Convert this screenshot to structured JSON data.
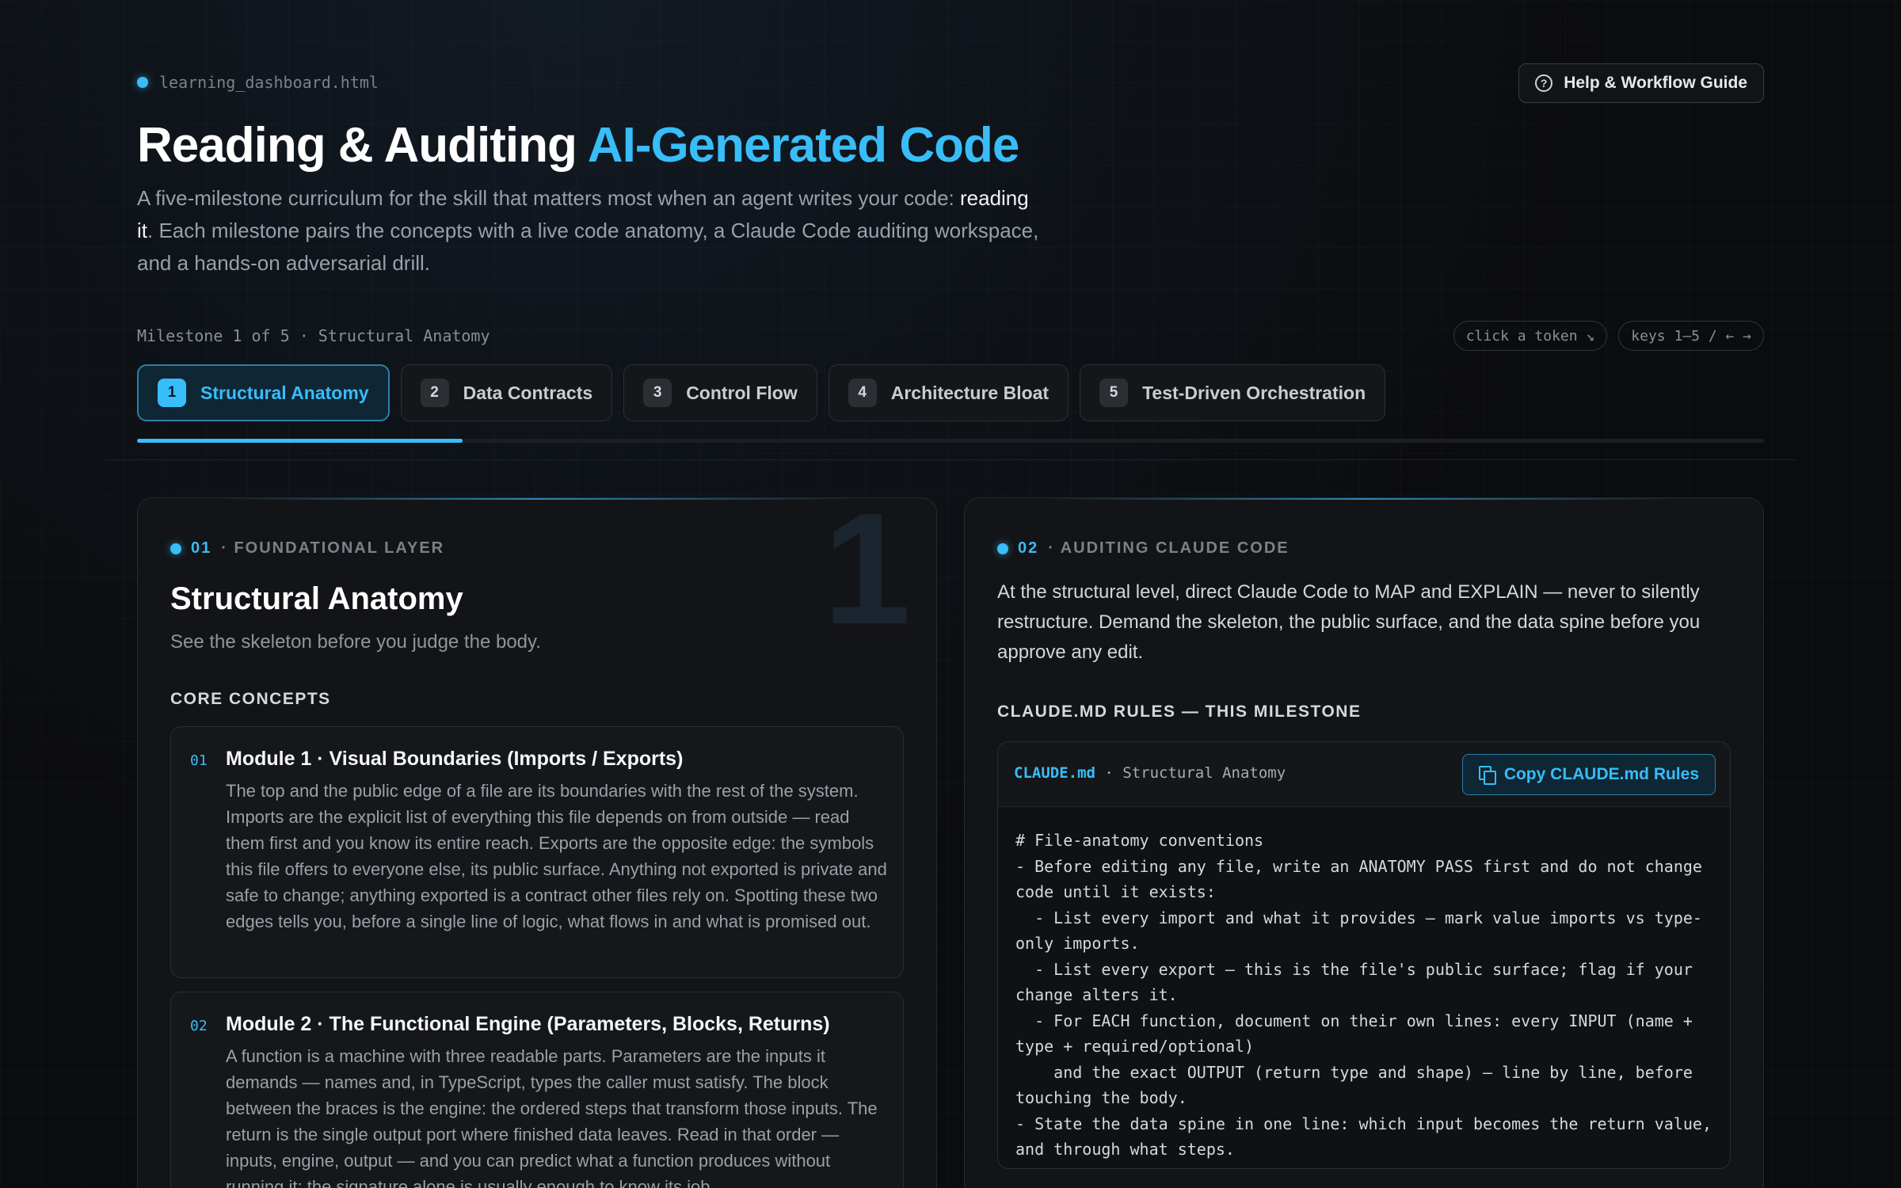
{
  "header": {
    "file_tag": "learning_dashboard.html",
    "help_label": "Help & Workflow Guide",
    "title_main": "Reading & Auditing ",
    "title_accent": "AI-Generated Code",
    "subtitle_part1": "A five-milestone curriculum for the skill that matters most when an agent writes your code: ",
    "subtitle_strong": "reading it",
    "subtitle_part2": ". Each milestone pairs the concepts with a live code anatomy, a Claude Code auditing workspace, and a hands-on adversarial drill."
  },
  "milestone_label": "Milestone 1 of 5 · Structural Anatomy",
  "hints": [
    "click a token ↘",
    "keys 1–5 / ← →"
  ],
  "tabs": [
    {
      "num": "1",
      "label": "Structural Anatomy"
    },
    {
      "num": "2",
      "label": "Data Contracts"
    },
    {
      "num": "3",
      "label": "Control Flow"
    },
    {
      "num": "4",
      "label": "Architecture Bloat"
    },
    {
      "num": "5",
      "label": "Test-Driven Orchestration"
    }
  ],
  "progress_fraction": 0.2,
  "left_panel": {
    "section_num": "01",
    "section_label": "· FOUNDATIONAL LAYER",
    "big_num": "1",
    "title": "Structural Anatomy",
    "subtitle": "See the skeleton before you judge the body.",
    "concepts_label": "CORE CONCEPTS",
    "modules": [
      {
        "num": "01",
        "title": "Module 1 · Visual Boundaries (Imports / Exports)",
        "body": "The top and the public edge of a file are its boundaries with the rest of the system. Imports are the explicit list of everything this file depends on from outside — read them first and you know its entire reach. Exports are the opposite edge: the symbols this file offers to everyone else, its public surface. Anything not exported is private and safe to change; anything exported is a contract other files rely on. Spotting these two edges tells you, before a single line of logic, what flows in and what is promised out."
      },
      {
        "num": "02",
        "title": "Module 2 · The Functional Engine (Parameters, Blocks, Returns)",
        "body": "A function is a machine with three readable parts. Parameters are the inputs it demands — names and, in TypeScript, types the caller must satisfy. The block between the braces is the engine: the ordered steps that transform those inputs. The return is the single output port where finished data leaves. Read in that order — inputs, engine, output — and you can predict what a function produces without running it; the signature alone is usually enough to know its job."
      }
    ]
  },
  "right_panel": {
    "section_num": "02",
    "section_label": "· AUDITING CLAUDE CODE",
    "intro": "At the structural level, direct Claude Code to MAP and EXPLAIN — never to silently restructure. Demand the skeleton, the public surface, and the data spine before you approve any edit.",
    "rules_label": "CLAUDE.MD RULES — THIS MILESTONE",
    "code_file": "CLAUDE.md",
    "code_file_suffix": " · Structural Anatomy",
    "copy_label": "Copy CLAUDE.md Rules",
    "code": "# File-anatomy conventions\n- Before editing any file, write an ANATOMY PASS first and do not change code until it exists:\n  - List every import and what it provides — mark value imports vs type-only imports.\n  - List every export — this is the file's public surface; flag if your change alters it.\n  - For EACH function, document on their own lines: every INPUT (name + type + required/optional)\n    and the exact OUTPUT (return type and shape) — line by line, before touching the body.\n- State the data spine in one line: which input becomes the return value, and through what steps."
  }
}
